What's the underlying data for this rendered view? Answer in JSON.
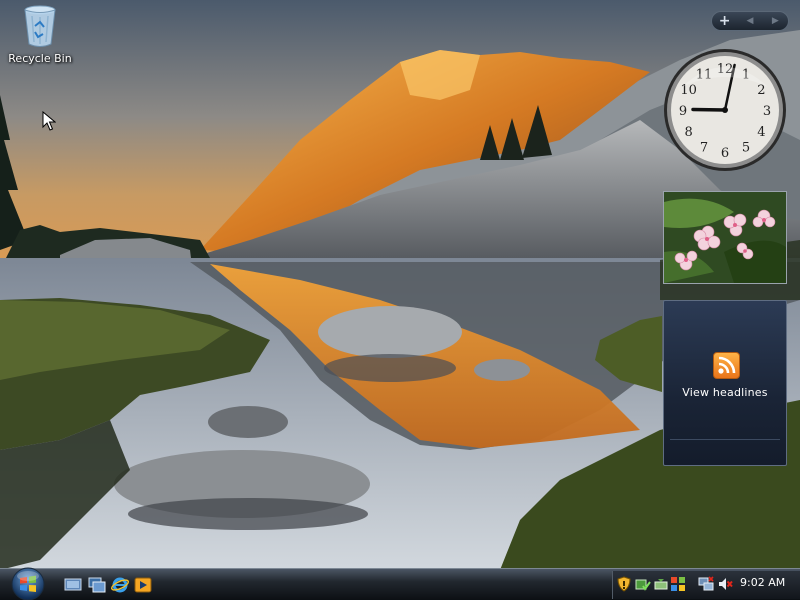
{
  "desktop": {
    "icons": [
      {
        "label": "Recycle Bin",
        "icon": "recycle-bin-icon"
      }
    ]
  },
  "sidebar": {
    "controls": {
      "add": "+",
      "prev": "◀",
      "next": "▶"
    },
    "clock": {
      "hour": 9,
      "minute": 2,
      "numerals": [
        "12",
        "1",
        "2",
        "3",
        "4",
        "5",
        "6",
        "7",
        "8",
        "9",
        "10",
        "11"
      ]
    },
    "feed": {
      "label": "View headlines",
      "icon": "rss-icon",
      "accent": "#f28c28"
    }
  },
  "taskbar": {
    "start": {
      "icon": "windows-orb-icon"
    },
    "quick_launch": [
      "show-desktop-icon",
      "switch-windows-icon",
      "internet-explorer-icon",
      "media-player-icon"
    ],
    "tray_icons": [
      "security-shield-icon",
      "network-check-icon",
      "safely-remove-icon",
      "windows-update-icon",
      "network-icon",
      "volume-muted-icon"
    ],
    "time": "9:02 AM"
  }
}
